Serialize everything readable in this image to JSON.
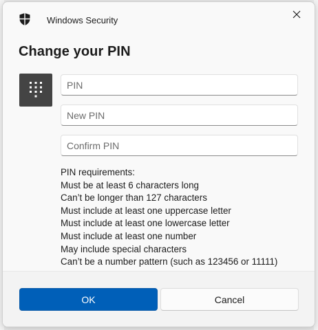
{
  "window": {
    "app_title": "Windows Security",
    "close_icon": "close-icon",
    "app_icon": "shield-icon"
  },
  "dialog": {
    "heading": "Change your PIN",
    "keypad_icon": "keypad-icon"
  },
  "fields": {
    "pin_placeholder": "PIN",
    "new_pin_placeholder": "New PIN",
    "confirm_pin_placeholder": "Confirm PIN"
  },
  "requirements": [
    "PIN requirements:",
    "Must be at least 6 characters long",
    "Can’t be longer than 127 characters",
    "Must include at least one uppercase letter",
    "Must include at least one lowercase letter",
    "Must include at least one number",
    "May include special characters",
    "Can’t be a number pattern (such as 123456 or 11111)"
  ],
  "buttons": {
    "ok_label": "OK",
    "cancel_label": "Cancel"
  },
  "colors": {
    "accent": "#005fb8",
    "keypad_bg": "#444444"
  }
}
